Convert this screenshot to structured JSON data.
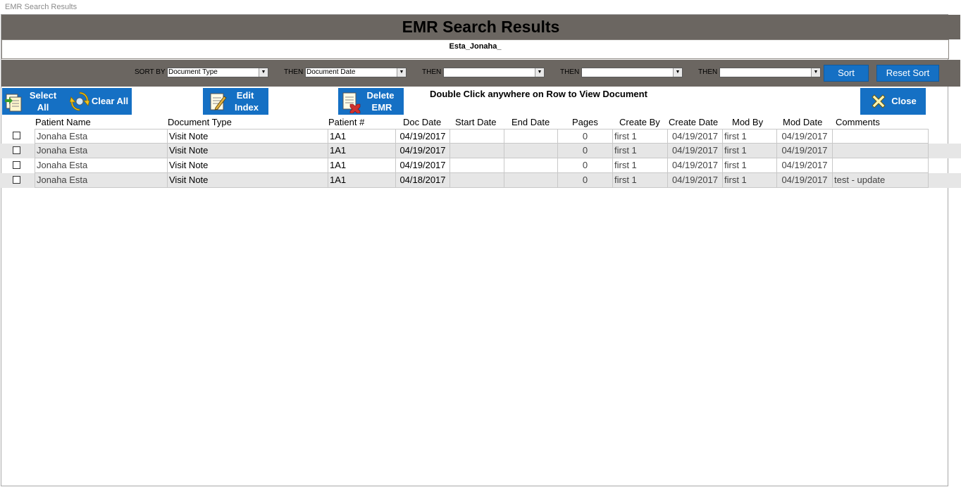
{
  "window": {
    "title": "EMR Search Results"
  },
  "header": {
    "title": "EMR Search Results"
  },
  "patient": {
    "name": "Esta_Jonaha_"
  },
  "sort": {
    "labels": [
      "SORT BY",
      "THEN",
      "THEN",
      "THEN",
      "THEN"
    ],
    "values": [
      "Document Type",
      "Document Date",
      "",
      "",
      ""
    ],
    "sort_label": "Sort",
    "reset_label": "Reset Sort"
  },
  "toolbar": {
    "select_all": [
      "Select",
      "All"
    ],
    "clear_all": "Clear All",
    "edit_index": [
      "Edit",
      "Index"
    ],
    "delete_emr": [
      "Delete",
      "EMR"
    ],
    "hint": "Double Click anywhere on Row to View Document",
    "close": "Close"
  },
  "table": {
    "columns": [
      "Patient Name",
      "Document Type",
      "Patient #",
      "Doc Date",
      "Start Date",
      "End Date",
      "Pages",
      "Create By",
      "Create Date",
      "Mod By",
      "Mod Date",
      "Comments"
    ],
    "rows": [
      {
        "patient_name": "Jonaha Esta",
        "document_type": "Visit Note",
        "patient_no": "1A1",
        "doc_date": "04/19/2017",
        "start_date": "",
        "end_date": "",
        "pages": "0",
        "create_by": "first 1",
        "create_date": "04/19/2017",
        "mod_by": "first 1",
        "mod_date": "04/19/2017",
        "comments": ""
      },
      {
        "patient_name": "Jonaha Esta",
        "document_type": "Visit Note",
        "patient_no": "1A1",
        "doc_date": "04/19/2017",
        "start_date": "",
        "end_date": "",
        "pages": "0",
        "create_by": "first 1",
        "create_date": "04/19/2017",
        "mod_by": "first 1",
        "mod_date": "04/19/2017",
        "comments": ""
      },
      {
        "patient_name": "Jonaha Esta",
        "document_type": "Visit Note",
        "patient_no": "1A1",
        "doc_date": "04/19/2017",
        "start_date": "",
        "end_date": "",
        "pages": "0",
        "create_by": "first 1",
        "create_date": "04/19/2017",
        "mod_by": "first 1",
        "mod_date": "04/19/2017",
        "comments": ""
      },
      {
        "patient_name": "Jonaha Esta",
        "document_type": "Visit Note",
        "patient_no": "1A1",
        "doc_date": "04/18/2017",
        "start_date": "",
        "end_date": "",
        "pages": "0",
        "create_by": "first 1",
        "create_date": "04/19/2017",
        "mod_by": "first 1",
        "mod_date": "04/19/2017",
        "comments": "test - update"
      }
    ]
  },
  "colors": {
    "header_band": "#6b6661",
    "button_blue": "#1570c4",
    "alt_row": "#e6e6e6"
  },
  "icons": [
    "select-all-icon",
    "clear-all-icon",
    "edit-index-icon",
    "delete-emr-icon",
    "close-icon"
  ]
}
